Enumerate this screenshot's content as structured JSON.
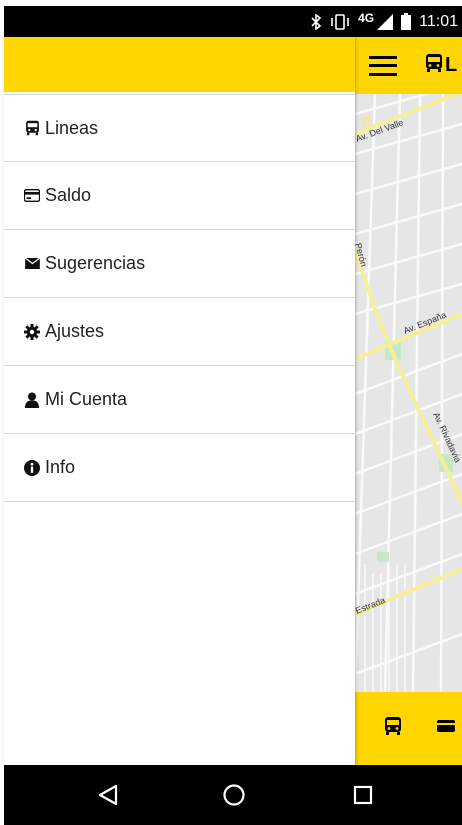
{
  "status_bar": {
    "network": "4G",
    "time": "11:01",
    "icons": [
      "bluetooth-icon",
      "vibrate-icon",
      "signal-icon",
      "battery-icon"
    ]
  },
  "drawer": {
    "items": [
      {
        "label": "Lineas",
        "icon": "bus-icon"
      },
      {
        "label": "Saldo",
        "icon": "card-icon"
      },
      {
        "label": "Sugerencias",
        "icon": "envelope-icon"
      },
      {
        "label": "Ajustes",
        "icon": "gear-icon"
      },
      {
        "label": "Mi Cuenta",
        "icon": "user-icon"
      },
      {
        "label": "Info",
        "icon": "info-icon"
      }
    ]
  },
  "app": {
    "toolbar_title_partial": "L",
    "map_labels": {
      "del_valle": "Av. Del Valle",
      "peron": "Perón",
      "espana": "Av. España",
      "rivadavia": "Av. Rivadavia",
      "estrada": "Estrada"
    }
  },
  "colors": {
    "accent": "#ffd600",
    "status_bar": "#000000",
    "map_background": "#e6e6e6",
    "road_major": "#f4f09a"
  }
}
